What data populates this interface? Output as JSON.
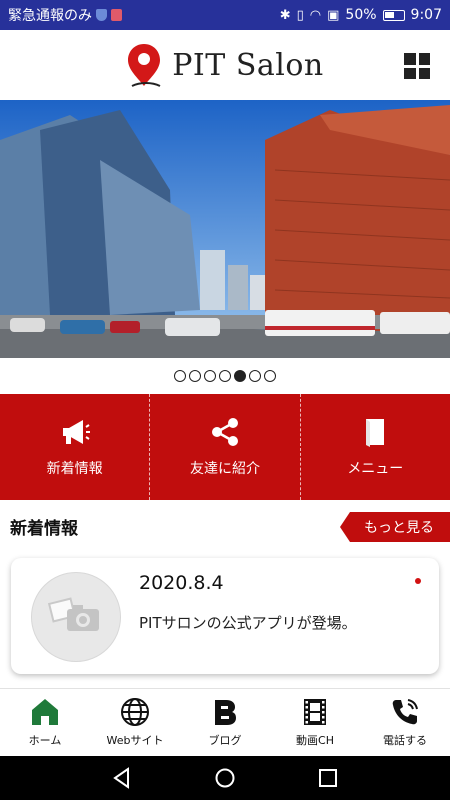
{
  "status_bar": {
    "left_text": "緊急通報のみ",
    "battery": "50%",
    "time": "9:07"
  },
  "header": {
    "brand": "PIT Salon",
    "menu_icon": "grid-icon"
  },
  "hero": {
    "slide_count": 7,
    "active_index": 4
  },
  "quick_menu": [
    {
      "label": "新着情報",
      "icon": "megaphone-icon"
    },
    {
      "label": "友達に紹介",
      "icon": "share-icon"
    },
    {
      "label": "メニュー",
      "icon": "book-icon"
    }
  ],
  "news": {
    "section_title": "新着情報",
    "more_label": "もっと見る",
    "items": [
      {
        "date": "2020.8.4",
        "text": "PITサロンの公式アプリが登場。",
        "unread": true
      }
    ]
  },
  "tabbar": [
    {
      "label": "ホーム",
      "icon": "home-icon",
      "active": true
    },
    {
      "label": "Webサイト",
      "icon": "globe-icon",
      "active": false
    },
    {
      "label": "ブログ",
      "icon": "blog-icon",
      "active": false
    },
    {
      "label": "動画CH",
      "icon": "film-icon",
      "active": false
    },
    {
      "label": "電話する",
      "icon": "phone-icon",
      "active": false
    }
  ],
  "colors": {
    "status_bar": "#27319a",
    "accent": "#c00d0d",
    "home_active": "#1f7a3a"
  }
}
